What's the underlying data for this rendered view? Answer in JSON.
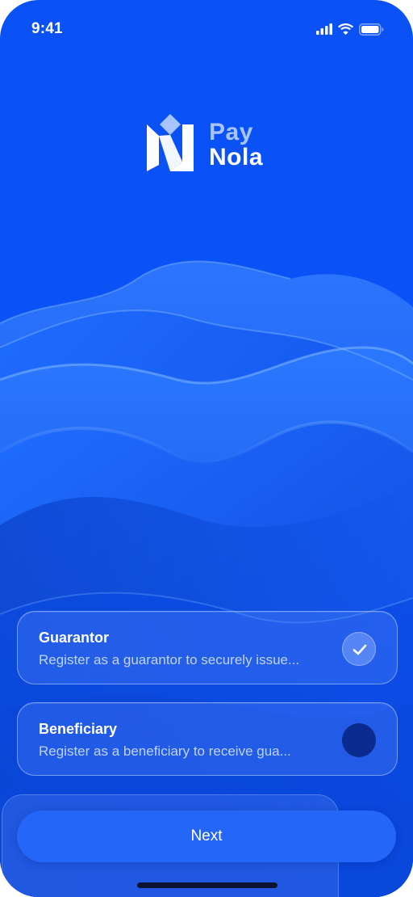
{
  "status_bar": {
    "time": "9:41",
    "icons": [
      "signal-icon",
      "wifi-icon",
      "battery-icon"
    ]
  },
  "brand": {
    "line1": "Pay",
    "line2": "Nola",
    "icon": "paynola-logo-icon"
  },
  "roles": [
    {
      "title": "Guarantor",
      "description": "Register as a guarantor to securely issue...",
      "selected": true,
      "icon": "check-icon"
    },
    {
      "title": "Beneficiary",
      "description": "Register as a beneficiary to receive gua...",
      "selected": false
    }
  ],
  "actions": {
    "next_label": "Next"
  },
  "colors": {
    "background": "#0A52F5",
    "button": "#2466F7",
    "brand_light": "#A8C4FF",
    "radio_empty": "#0B2A8F"
  }
}
